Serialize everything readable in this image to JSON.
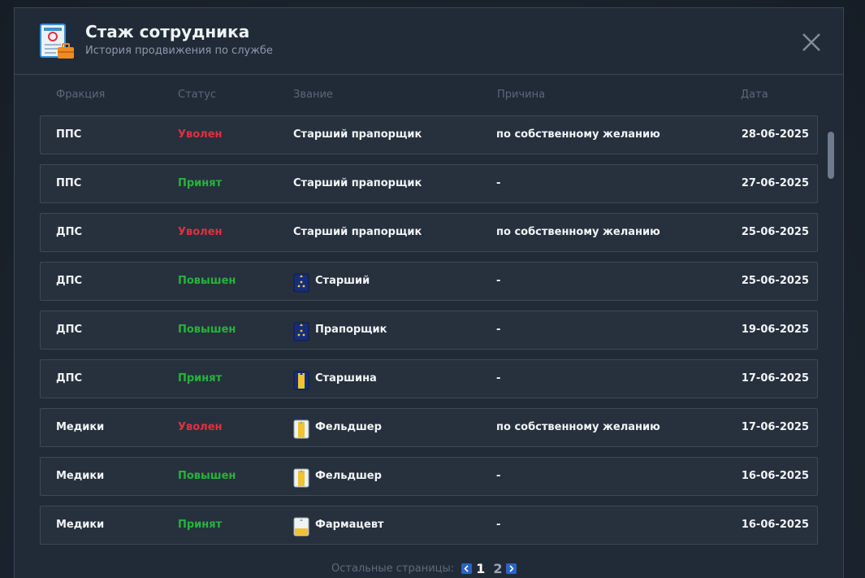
{
  "dialog": {
    "title": "Стаж сотрудника",
    "subtitle": "История продвижения по службе"
  },
  "columns": {
    "faction": "Фракция",
    "status": "Статус",
    "rank": "Звание",
    "reason": "Причина",
    "date": "Дата"
  },
  "rows": [
    {
      "faction": "ППС",
      "status": "Уволен",
      "status_type": "fired",
      "rank": "Старший прапорщик",
      "rank_icon": "",
      "reason": "по собственному желанию",
      "date": "28-06-2025"
    },
    {
      "faction": "ППС",
      "status": "Принят",
      "status_type": "hired",
      "rank": "Старший прапорщик",
      "rank_icon": "",
      "reason": "-",
      "date": "27-06-2025"
    },
    {
      "faction": "ДПС",
      "status": "Уволен",
      "status_type": "fired",
      "rank": "Старший прапорщик",
      "rank_icon": "",
      "reason": "по собственному желанию",
      "date": "25-06-2025"
    },
    {
      "faction": "ДПС",
      "status": "Повышен",
      "status_type": "promoted",
      "rank": "Старший",
      "rank_icon": "police-shoulder-strap-icon",
      "reason": "-",
      "date": "25-06-2025"
    },
    {
      "faction": "ДПС",
      "status": "Повышен",
      "status_type": "promoted",
      "rank": "Прапорщик",
      "rank_icon": "police-shoulder-strap-icon",
      "reason": "-",
      "date": "19-06-2025"
    },
    {
      "faction": "ДПС",
      "status": "Принят",
      "status_type": "hired",
      "rank": "Старшина",
      "rank_icon": "police-sergeant-strap-icon",
      "reason": "-",
      "date": "17-06-2025"
    },
    {
      "faction": "Медики",
      "status": "Уволен",
      "status_type": "fired",
      "rank": "Фельдшер",
      "rank_icon": "medic-strap-icon",
      "reason": "по собственному желанию",
      "date": "17-06-2025"
    },
    {
      "faction": "Медики",
      "status": "Повышен",
      "status_type": "promoted",
      "rank": "Фельдшер",
      "rank_icon": "medic-strap-icon",
      "reason": "-",
      "date": "16-06-2025"
    },
    {
      "faction": "Медики",
      "status": "Принят",
      "status_type": "hired",
      "rank": "Фармацевт",
      "rank_icon": "pharmacist-strap-icon",
      "reason": "-",
      "date": "16-06-2025"
    }
  ],
  "pagination": {
    "label": "Остальные страницы:",
    "current": "1",
    "other": "2"
  },
  "colors": {
    "fired": "#e0303f",
    "hired": "#26b33b",
    "promoted": "#26b33b"
  },
  "icons": {
    "header": "document-briefcase-icon",
    "close": "close-icon",
    "prev": "chevron-left-icon",
    "next": "chevron-right-icon"
  }
}
